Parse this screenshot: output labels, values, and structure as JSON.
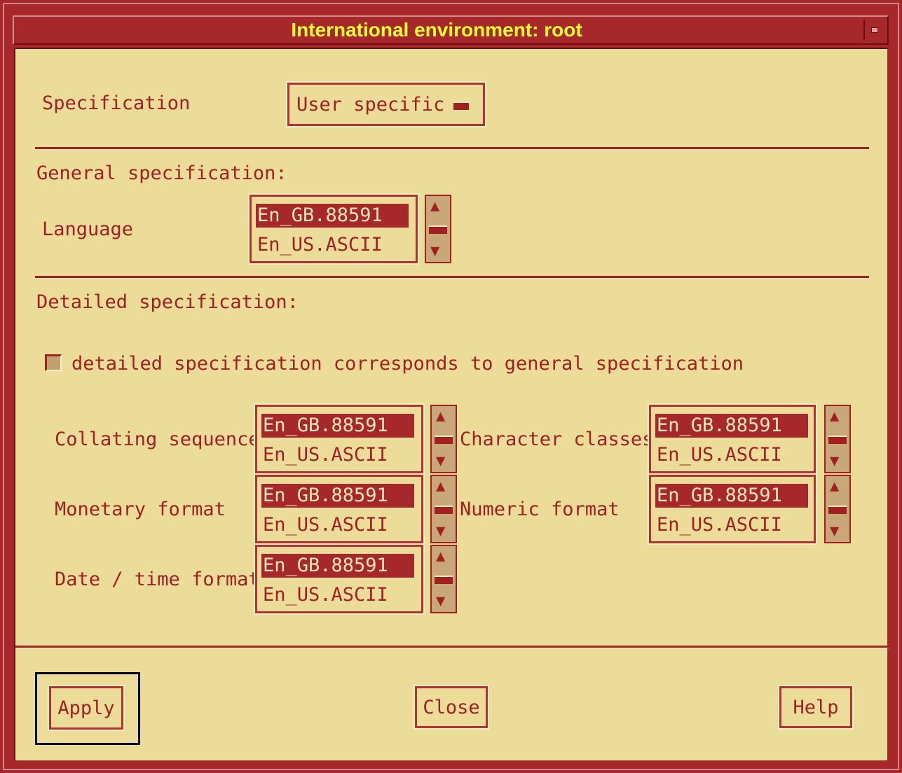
{
  "window": {
    "title": "International environment: root"
  },
  "specification": {
    "label": "Specification",
    "value": "User specific"
  },
  "general": {
    "heading": "General specification:",
    "language": {
      "label": "Language",
      "items": [
        "En_GB.88591",
        "En_US.ASCII"
      ],
      "selected": "En_GB.88591"
    }
  },
  "detailed": {
    "heading": "Detailed specification:",
    "checkbox_label": "detailed specification corresponds to general specification",
    "checkbox_checked": false,
    "collating": {
      "label": "Collating sequence",
      "items": [
        "En_GB.88591",
        "En_US.ASCII"
      ]
    },
    "character": {
      "label": "Character classes",
      "items": [
        "En_GB.88591",
        "En_US.ASCII"
      ]
    },
    "monetary": {
      "label": "Monetary format",
      "items": [
        "En_GB.88591",
        "En_US.ASCII"
      ]
    },
    "numeric": {
      "label": "Numeric format",
      "items": [
        "En_GB.88591",
        "En_US.ASCII"
      ]
    },
    "datetime": {
      "label": "Date / time format",
      "items": [
        "En_GB.88591",
        "En_US.ASCII"
      ]
    }
  },
  "buttons": {
    "apply": "Apply",
    "close": "Close",
    "help": "Help"
  },
  "icons": {
    "window_menu": "window-menu-icon",
    "scroll_up": "▲",
    "scroll_down": "▼",
    "option_indicator": "option-menu-indicator-icon"
  },
  "colors": {
    "frame": "#a7282a",
    "title_text": "#ffff30",
    "background": "#ecdc9a",
    "text": "#a32020",
    "selection": "#a7282a"
  }
}
